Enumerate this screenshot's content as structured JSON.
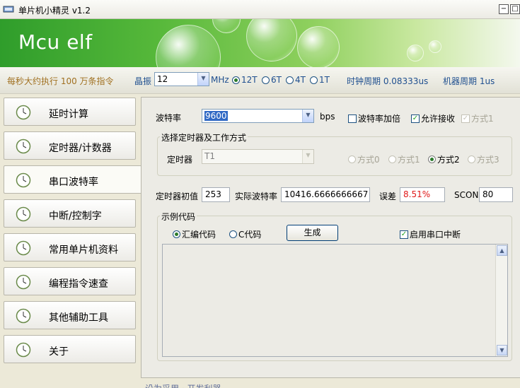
{
  "window": {
    "title": "单片机小精灵 v1.2"
  },
  "banner": {
    "title": "Mcu elf"
  },
  "infobar": {
    "ops_text": "每秒大约执行 100 万条指令",
    "crystal_label": "晶振",
    "crystal_value": "12",
    "mhz": "MHz",
    "cycle_options": [
      {
        "label": "12T",
        "selected": true
      },
      {
        "label": "6T",
        "selected": false
      },
      {
        "label": "4T",
        "selected": false
      },
      {
        "label": "1T",
        "selected": false
      }
    ],
    "clock_period": "时钟周期 0.08333us",
    "machine_period": "机器周期 1us"
  },
  "nav": [
    {
      "label": "延时计算",
      "active": false
    },
    {
      "label": "定时器/计数器",
      "active": false
    },
    {
      "label": "串口波特率",
      "active": true
    },
    {
      "label": "中断/控制字",
      "active": false
    },
    {
      "label": "常用单片机资料",
      "active": false
    },
    {
      "label": "编程指令速查",
      "active": false
    },
    {
      "label": "其他辅助工具",
      "active": false
    },
    {
      "label": "关于",
      "active": false
    }
  ],
  "baud": {
    "label": "波特率",
    "value": "9600",
    "unit": "bps",
    "double_label": "波特率加倍",
    "double_checked": false,
    "allow_rx_label": "允许接收",
    "allow_rx_checked": true,
    "mode1_label": "方式1",
    "mode1_checked": true
  },
  "timer_group": {
    "title": "选择定时器及工作方式",
    "timer_label": "定时器",
    "timer_value": "T1",
    "modes": [
      {
        "label": "方式0",
        "selected": false,
        "enabled": false
      },
      {
        "label": "方式1",
        "selected": false,
        "enabled": false
      },
      {
        "label": "方式2",
        "selected": true,
        "enabled": true
      },
      {
        "label": "方式3",
        "selected": false,
        "enabled": false
      }
    ]
  },
  "results": {
    "init_label": "定时器初值",
    "init_value": "253",
    "actual_label": "实际波特率",
    "actual_value": "10416.6666666667",
    "error_label": "误差",
    "error_value": "8.51%",
    "scon_label": "SCON",
    "scon_value": "80"
  },
  "code_group": {
    "title": "示例代码",
    "asm_label": "汇编代码",
    "asm_selected": true,
    "c_label": "C代码",
    "c_selected": false,
    "generate_label": "生成",
    "enable_int_label": "启用串口中断",
    "enable_int_checked": true,
    "code_text": ""
  },
  "footer": {
    "text": "设为采用 · 开发利器"
  },
  "colors": {
    "banner_green": "#3aa531",
    "error_red": "#e01818",
    "accent_blue": "#1f4f8f"
  }
}
